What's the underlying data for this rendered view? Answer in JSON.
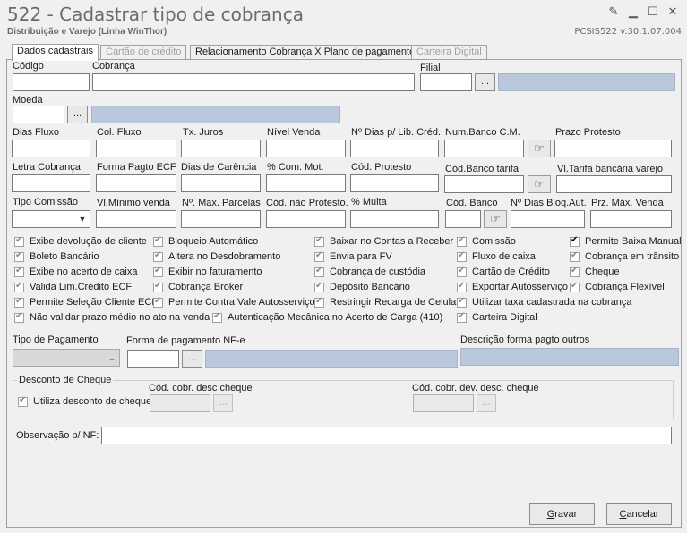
{
  "window": {
    "title": "522 - Cadastrar tipo de cobrança",
    "subtitle": "Distribuição e Varejo (Linha WinThor)",
    "version": "PCSIS522  v.30.1.07.004"
  },
  "tabs": [
    {
      "label": "Dados cadastrais"
    },
    {
      "label": "Cartão de crédito"
    },
    {
      "label": "Relacionamento Cobrança X Plano de pagamento"
    },
    {
      "label": "Carteira Digital"
    }
  ],
  "fields": {
    "codigo": "Código",
    "cobranca": "Cobrança",
    "filial": "Filial",
    "moeda": "Moeda",
    "dias_fluxo": "Dias Fluxo",
    "col_fluxo": "Col. Fluxo",
    "tx_juros": "Tx. Juros",
    "nivel_venda": "Nível Venda",
    "n_dias_lib": "Nº Dias p/ Lib. Créd.",
    "num_banco": "Num.Banco C.M.",
    "prazo_protesto": "Prazo Protesto",
    "letra_cobranca": "Letra Cobrança",
    "forma_pagto_ecf": "Forma Pagto ECF",
    "dias_carencia": "Dias de Carência",
    "com_mot": "% Com. Mot.",
    "cod_protesto": "Cód. Protesto",
    "cod_banco_tarifa": "Cód.Banco tarifa",
    "vl_tarifa": "Vl.Tarifa bancária varejo",
    "tipo_comissao": "Tipo Comissão",
    "vl_minimo_venda": "Vl.Mínimo venda",
    "n_max_parcelas": "Nº. Max. Parcelas",
    "cod_nao_protesto": "Cód. não Protesto.",
    "multa": "% Multa",
    "cod_banco": "Cód. Banco",
    "n_dias_bloq": "Nº Dias Bloq.Aut.",
    "prz_max_venda": "Prz. Máx. Venda",
    "tipo_pagamento": "Tipo de Pagamento",
    "forma_pagamento_nfe": "Forma de pagamento NF-e",
    "descricao_forma_pagto": "Descrição forma pagto outros",
    "observacao": "Observação p/ NF:"
  },
  "browse_label": "...",
  "checkboxes": [
    {
      "label": "Exibe devolução de cliente",
      "checked": true
    },
    {
      "label": "Boleto Bancário",
      "checked": true
    },
    {
      "label": "Exibe no acerto de caixa",
      "checked": true
    },
    {
      "label": "Valida Lim.Crédito ECF",
      "checked": true
    },
    {
      "label": "Permite Seleção Cliente ECF",
      "checked": true
    },
    {
      "label": "Não validar prazo médio no ato na venda",
      "checked": true
    },
    {
      "label": "Bloqueio Automático",
      "checked": true
    },
    {
      "label": "Altera no Desdobramento",
      "checked": true
    },
    {
      "label": "Exibir no faturamento",
      "checked": true
    },
    {
      "label": "Cobrança Broker",
      "checked": true
    },
    {
      "label": "Permite Contra Vale Autosserviço",
      "checked": true
    },
    {
      "label": "Autenticação Mecânica no Acerto de Carga (410)",
      "checked": true
    },
    {
      "label": "Baixar no Contas a Receber",
      "checked": true
    },
    {
      "label": "Envia para FV",
      "checked": true
    },
    {
      "label": "Cobrança de custódia",
      "checked": true
    },
    {
      "label": "Depósito Bancário",
      "checked": true
    },
    {
      "label": "Restringir Recarga de Celular",
      "checked": true
    },
    {
      "label": "Comissão",
      "checked": true
    },
    {
      "label": "Fluxo de caixa",
      "checked": true
    },
    {
      "label": "Cartão de Crédito",
      "checked": true
    },
    {
      "label": "Exportar Autosserviço",
      "checked": true
    },
    {
      "label": "Utilizar taxa cadastrada na cobrança",
      "checked": true
    },
    {
      "label": "Carteira Digital",
      "checked": true
    },
    {
      "label": "Permite Baixa Manual",
      "checked": true
    },
    {
      "label": "Cobrança em trânsito",
      "checked": true
    },
    {
      "label": "Cheque",
      "checked": true
    },
    {
      "label": "Cobrança Flexível",
      "checked": true
    }
  ],
  "desconto_cheque": {
    "title": "Desconto de Cheque",
    "utiliza_label": "Utiliza desconto de cheque",
    "cod_cobr_desc": "Cód. cobr. desc cheque",
    "cod_cobr_dev": "Cód. cobr. dev. desc. cheque"
  },
  "buttons": {
    "gravar_prefix": "",
    "gravar_ul": "G",
    "gravar_rest": "ravar",
    "cancelar_prefix": "",
    "cancelar_ul": "C",
    "cancelar_rest": "ancelar"
  }
}
